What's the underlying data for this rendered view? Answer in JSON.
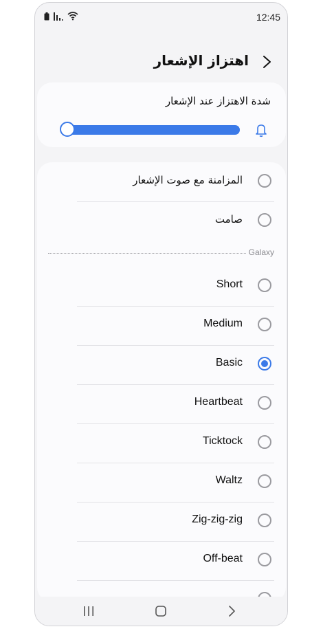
{
  "status_bar": {
    "time": "12:45"
  },
  "header": {
    "title": "اهتزاز الإشعار"
  },
  "intensity": {
    "label": "شدة الاهتزاز عند الإشعار",
    "level": 0.0
  },
  "options_top": [
    {
      "label": "المزامنة مع صوت الإشعار",
      "checked": false
    },
    {
      "label": "صامت",
      "checked": false
    }
  ],
  "section": {
    "title": "Galaxy"
  },
  "patterns": [
    {
      "label": "Short",
      "checked": false
    },
    {
      "label": "Medium",
      "checked": false
    },
    {
      "label": "Basic",
      "checked": true
    },
    {
      "label": "Heartbeat",
      "checked": false
    },
    {
      "label": "Ticktock",
      "checked": false
    },
    {
      "label": "Waltz",
      "checked": false
    },
    {
      "label": "Zig-zig-zig",
      "checked": false
    },
    {
      "label": "Off-beat",
      "checked": false
    }
  ],
  "colors": {
    "accent": "#3b7ae8"
  }
}
